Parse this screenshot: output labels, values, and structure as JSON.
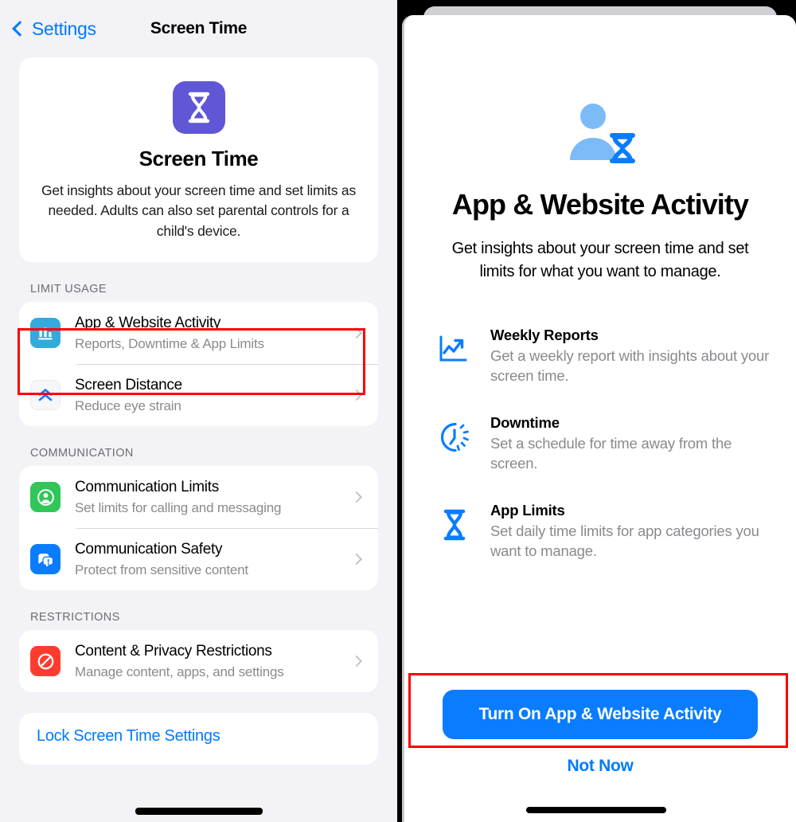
{
  "left": {
    "nav": {
      "back_label": "Settings",
      "title": "Screen Time",
      "back_icon": "chevron-left-icon"
    },
    "hero": {
      "icon": "hourglass-icon",
      "title": "Screen Time",
      "description": "Get insights about your screen time and set limits as needed. Adults can also set parental controls for a child's device."
    },
    "sections": [
      {
        "header": "LIMIT USAGE",
        "rows": [
          {
            "icon": "bar-chart-icon",
            "icon_color": "#34aadc",
            "title": "App & Website Activity",
            "subtitle": "Reports, Downtime & App Limits",
            "highlighted": true
          },
          {
            "icon": "chevrons-up-icon",
            "icon_color": "#f7f7f9",
            "title": "Screen Distance",
            "subtitle": "Reduce eye strain",
            "highlighted": false
          }
        ]
      },
      {
        "header": "COMMUNICATION",
        "rows": [
          {
            "icon": "person-circle-icon",
            "icon_color": "#30c659",
            "title": "Communication Limits",
            "subtitle": "Set limits for calling and messaging",
            "highlighted": false
          },
          {
            "icon": "message-alert-icon",
            "icon_color": "#0a7cff",
            "title": "Communication Safety",
            "subtitle": "Protect from sensitive content",
            "highlighted": false
          }
        ]
      },
      {
        "header": "RESTRICTIONS",
        "rows": [
          {
            "icon": "no-entry-icon",
            "icon_color": "#ff3b30",
            "title": "Content & Privacy Restrictions",
            "subtitle": "Manage content, apps, and settings",
            "highlighted": false
          }
        ]
      }
    ],
    "footer": {
      "link_label": "Lock Screen Time Settings"
    }
  },
  "right": {
    "hero": {
      "icon": "person-hourglass-icon",
      "title": "App & Website Activity",
      "description": "Get insights about your screen time and set limits for what you want to manage."
    },
    "features": [
      {
        "icon": "chart-trend-up-icon",
        "title": "Weekly Reports",
        "description": "Get a weekly report with insights about your screen time."
      },
      {
        "icon": "downtime-clock-icon",
        "title": "Downtime",
        "description": "Set a schedule for time away from the screen."
      },
      {
        "icon": "hourglass-icon",
        "title": "App Limits",
        "description": "Set daily time limits for app categories you want to manage."
      }
    ],
    "actions": {
      "primary_label": "Turn On App & Website Activity",
      "secondary_label": "Not Now"
    }
  },
  "annotations": {
    "highlight_color": "#ff0000",
    "targets": [
      "App & Website Activity row",
      "Turn On App & Website Activity button"
    ]
  },
  "colors": {
    "accent_blue": "#007aff",
    "button_blue": "#0a7cff",
    "screen_time_purple": "#5f57d6",
    "panel_background": "#f2f2f7",
    "card_background": "#ffffff",
    "secondary_text": "#8a8a8e"
  }
}
